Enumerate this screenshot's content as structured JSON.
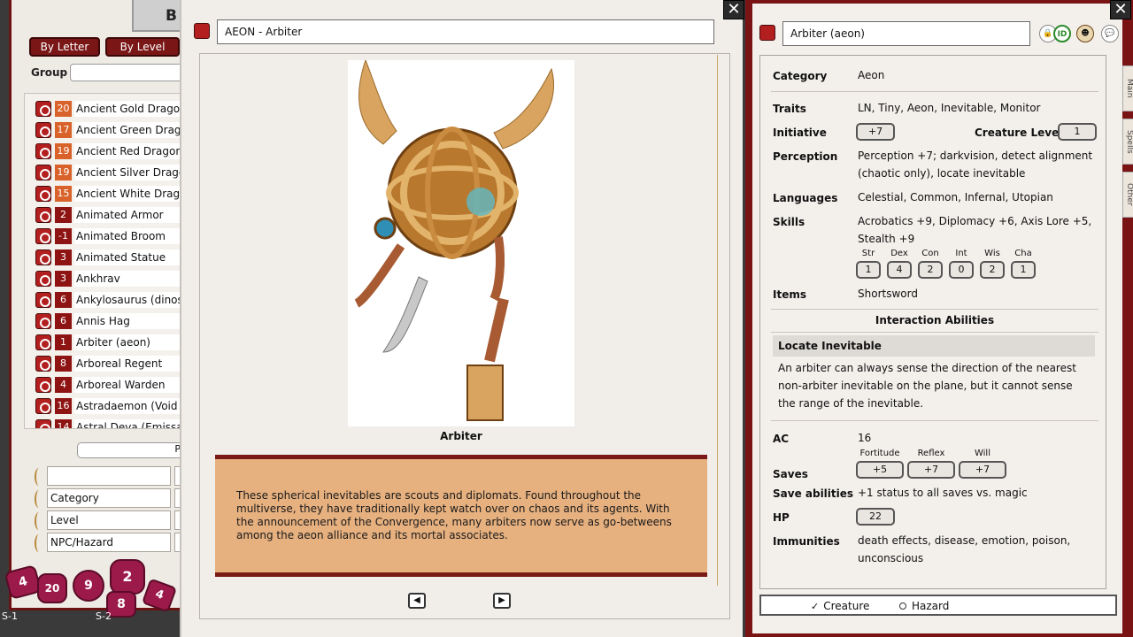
{
  "left_panel": {
    "tab_label": "B",
    "by_letter": "By Letter",
    "by_level": "By Level",
    "group_label": "Group",
    "items": [
      {
        "level": "20",
        "name": "Ancient Gold Dragon",
        "hi": true
      },
      {
        "level": "17",
        "name": "Ancient Green Dragon",
        "hi": true
      },
      {
        "level": "19",
        "name": "Ancient Red Dragon",
        "hi": true
      },
      {
        "level": "19",
        "name": "Ancient Silver Dragon",
        "hi": true
      },
      {
        "level": "15",
        "name": "Ancient White Dragon",
        "hi": true
      },
      {
        "level": "2",
        "name": "Animated Armor",
        "hi": false
      },
      {
        "level": "-1",
        "name": "Animated Broom",
        "hi": false
      },
      {
        "level": "3",
        "name": "Animated Statue",
        "hi": false
      },
      {
        "level": "3",
        "name": "Ankhrav",
        "hi": false
      },
      {
        "level": "6",
        "name": "Ankylosaurus (dinosaur)",
        "hi": false
      },
      {
        "level": "6",
        "name": "Annis Hag",
        "hi": false
      },
      {
        "level": "1",
        "name": "Arbiter (aeon)",
        "hi": false
      },
      {
        "level": "8",
        "name": "Arboreal Regent",
        "hi": false
      },
      {
        "level": "4",
        "name": "Arboreal Warden",
        "hi": false
      },
      {
        "level": "16",
        "name": "Astradaemon (Void Daemon)",
        "hi": false
      },
      {
        "level": "14",
        "name": "Astral Deva (Emissary)",
        "hi": false
      }
    ],
    "bottom_button": "P",
    "filters": [
      "Category",
      "Level",
      "NPC/Hazard"
    ],
    "slot1": "S-1",
    "slot2": "S-2"
  },
  "image_window": {
    "title": "AEON - Arbiter",
    "caption": "Arbiter",
    "description": "These spherical inevitables are scouts and diplomats. Found throughout the multiverse, they have traditionally kept watch over on chaos and its agents. With the announcement of the Convergence, many arbiters now serve as go-betweens among the aeon alliance and its mortal associates.",
    "prev": "◀",
    "next": "▶"
  },
  "stat_window": {
    "title": "Arbiter (aeon)",
    "category_label": "Category",
    "category": "Aeon",
    "traits_label": "Traits",
    "traits": "LN, Tiny, Aeon, Inevitable, Monitor",
    "initiative_label": "Initiative",
    "initiative": "+7",
    "creature_level_label": "Creature Level",
    "creature_level": "1",
    "perception_label": "Perception",
    "perception": "Perception +7; darkvision, detect alignment (chaotic only), locate inevitable",
    "languages_label": "Languages",
    "languages": "Celestial, Common, Infernal, Utopian",
    "skills_label": "Skills",
    "skills": "Acrobatics +9, Diplomacy +6, Axis Lore +5, Stealth +9",
    "abilities": [
      {
        "name": "Str",
        "value": "1"
      },
      {
        "name": "Dex",
        "value": "4"
      },
      {
        "name": "Con",
        "value": "2"
      },
      {
        "name": "Int",
        "value": "0"
      },
      {
        "name": "Wis",
        "value": "2"
      },
      {
        "name": "Cha",
        "value": "1"
      }
    ],
    "items_label": "Items",
    "items": "Shortsword",
    "interaction_header": "Interaction Abilities",
    "locate_header": "Locate Inevitable",
    "locate_text": "An arbiter can always sense the direction of the nearest non-arbiter inevitable on the plane, but it cannot sense the range of the inevitable.",
    "ac_label": "AC",
    "ac": "16",
    "saves_label": "Saves",
    "fortitude_label": "Fortitude",
    "fortitude": "+5",
    "reflex_label": "Reflex",
    "reflex": "+7",
    "will_label": "Will",
    "will": "+7",
    "save_abilities_label": "Save abilities",
    "save_abilities": "+1 status to all saves vs. magic",
    "hp_label": "HP",
    "hp": "22",
    "immunities_label": "Immunities",
    "immunities": "death effects, disease, emotion, poison, unconscious",
    "side_tabs": [
      "Main",
      "Spells",
      "Other"
    ],
    "radio_creature": "Creature",
    "radio_hazard": "Hazard",
    "header_icon_id": "ID"
  },
  "colors": {
    "accent": "#7a1414",
    "level_high": "#d9622b",
    "level_low": "#8e1414",
    "description_bg": "#e6b07f"
  }
}
